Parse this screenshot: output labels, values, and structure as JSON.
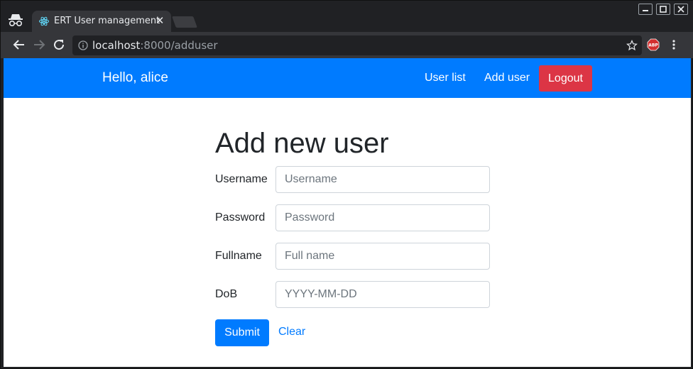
{
  "browser": {
    "tab": {
      "title": "ERT User management",
      "favicon": "react-icon"
    },
    "url": {
      "host": "localhost",
      "rest": ":8000/adduser"
    },
    "icons": [
      "incognito-icon",
      "back-icon",
      "forward-icon",
      "reload-icon",
      "info-icon",
      "star-icon",
      "adblock-icon",
      "menu-icon"
    ],
    "abp_label": "ABP"
  },
  "navbar": {
    "brand": "Hello, alice",
    "links": [
      "User list",
      "Add user"
    ],
    "logout": "Logout",
    "colors": {
      "bar": "#007bff",
      "logout": "#dc3545"
    }
  },
  "form": {
    "title": "Add new user",
    "fields": [
      {
        "label": "Username",
        "placeholder": "Username"
      },
      {
        "label": "Password",
        "placeholder": "Password"
      },
      {
        "label": "Fullname",
        "placeholder": "Full name"
      },
      {
        "label": "DoB",
        "placeholder": "YYYY-MM-DD"
      }
    ],
    "submit": "Submit",
    "clear": "Clear"
  }
}
